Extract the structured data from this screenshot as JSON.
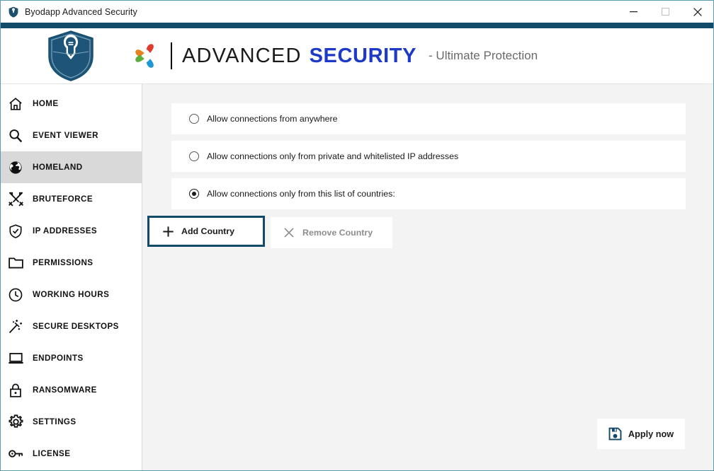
{
  "window": {
    "title": "Byodapp Advanced Security",
    "icon": "shield-icon",
    "controls": {
      "minimize": "minimize-icon",
      "maximize": "maximize-icon",
      "close": "close-icon"
    }
  },
  "header": {
    "shield_logo": "knight-shield-logo",
    "swirl_logo": "colored-swirl-logo",
    "brand_part1": "ADVANCED",
    "brand_part2": "SECURITY",
    "tagline": "- Ultimate Protection",
    "colors": {
      "accent_bar": "#124b69",
      "brand_part2_color": "#1c39c7",
      "tagline_color": "#6a6a6a"
    }
  },
  "sidebar": {
    "items": [
      {
        "label": "HOME",
        "icon": "home-icon",
        "active": false
      },
      {
        "label": "EVENT VIEWER",
        "icon": "magnifier-icon",
        "active": false
      },
      {
        "label": "HOMELAND",
        "icon": "globe-icon",
        "active": true
      },
      {
        "label": "BRUTEFORCE",
        "icon": "crossed-swords-icon",
        "active": false
      },
      {
        "label": "IP ADDRESSES",
        "icon": "shield-check-icon",
        "active": false
      },
      {
        "label": "PERMISSIONS",
        "icon": "folder-icon",
        "active": false
      },
      {
        "label": "WORKING HOURS",
        "icon": "clock-icon",
        "active": false
      },
      {
        "label": "SECURE DESKTOPS",
        "icon": "magic-wand-icon",
        "active": false
      },
      {
        "label": "ENDPOINTS",
        "icon": "laptop-icon",
        "active": false
      },
      {
        "label": "RANSOMWARE",
        "icon": "padlock-icon",
        "active": false
      },
      {
        "label": "SETTINGS",
        "icon": "gear-icon",
        "active": false
      },
      {
        "label": "LICENSE",
        "icon": "key-icon",
        "active": false
      }
    ]
  },
  "main": {
    "options": [
      {
        "label": "Allow connections from anywhere",
        "selected": false
      },
      {
        "label": "Allow connections only from private and whitelisted IP addresses",
        "selected": false
      },
      {
        "label": "Allow connections only from this list of countries:",
        "selected": true
      }
    ],
    "buttons": {
      "add_country": {
        "label": "Add Country",
        "icon": "plus-icon",
        "focused": true,
        "disabled": false
      },
      "remove_country": {
        "label": "Remove Country",
        "icon": "cross-icon",
        "focused": false,
        "disabled": true
      }
    },
    "apply": {
      "label": "Apply now",
      "icon": "save-floppy-icon"
    }
  }
}
